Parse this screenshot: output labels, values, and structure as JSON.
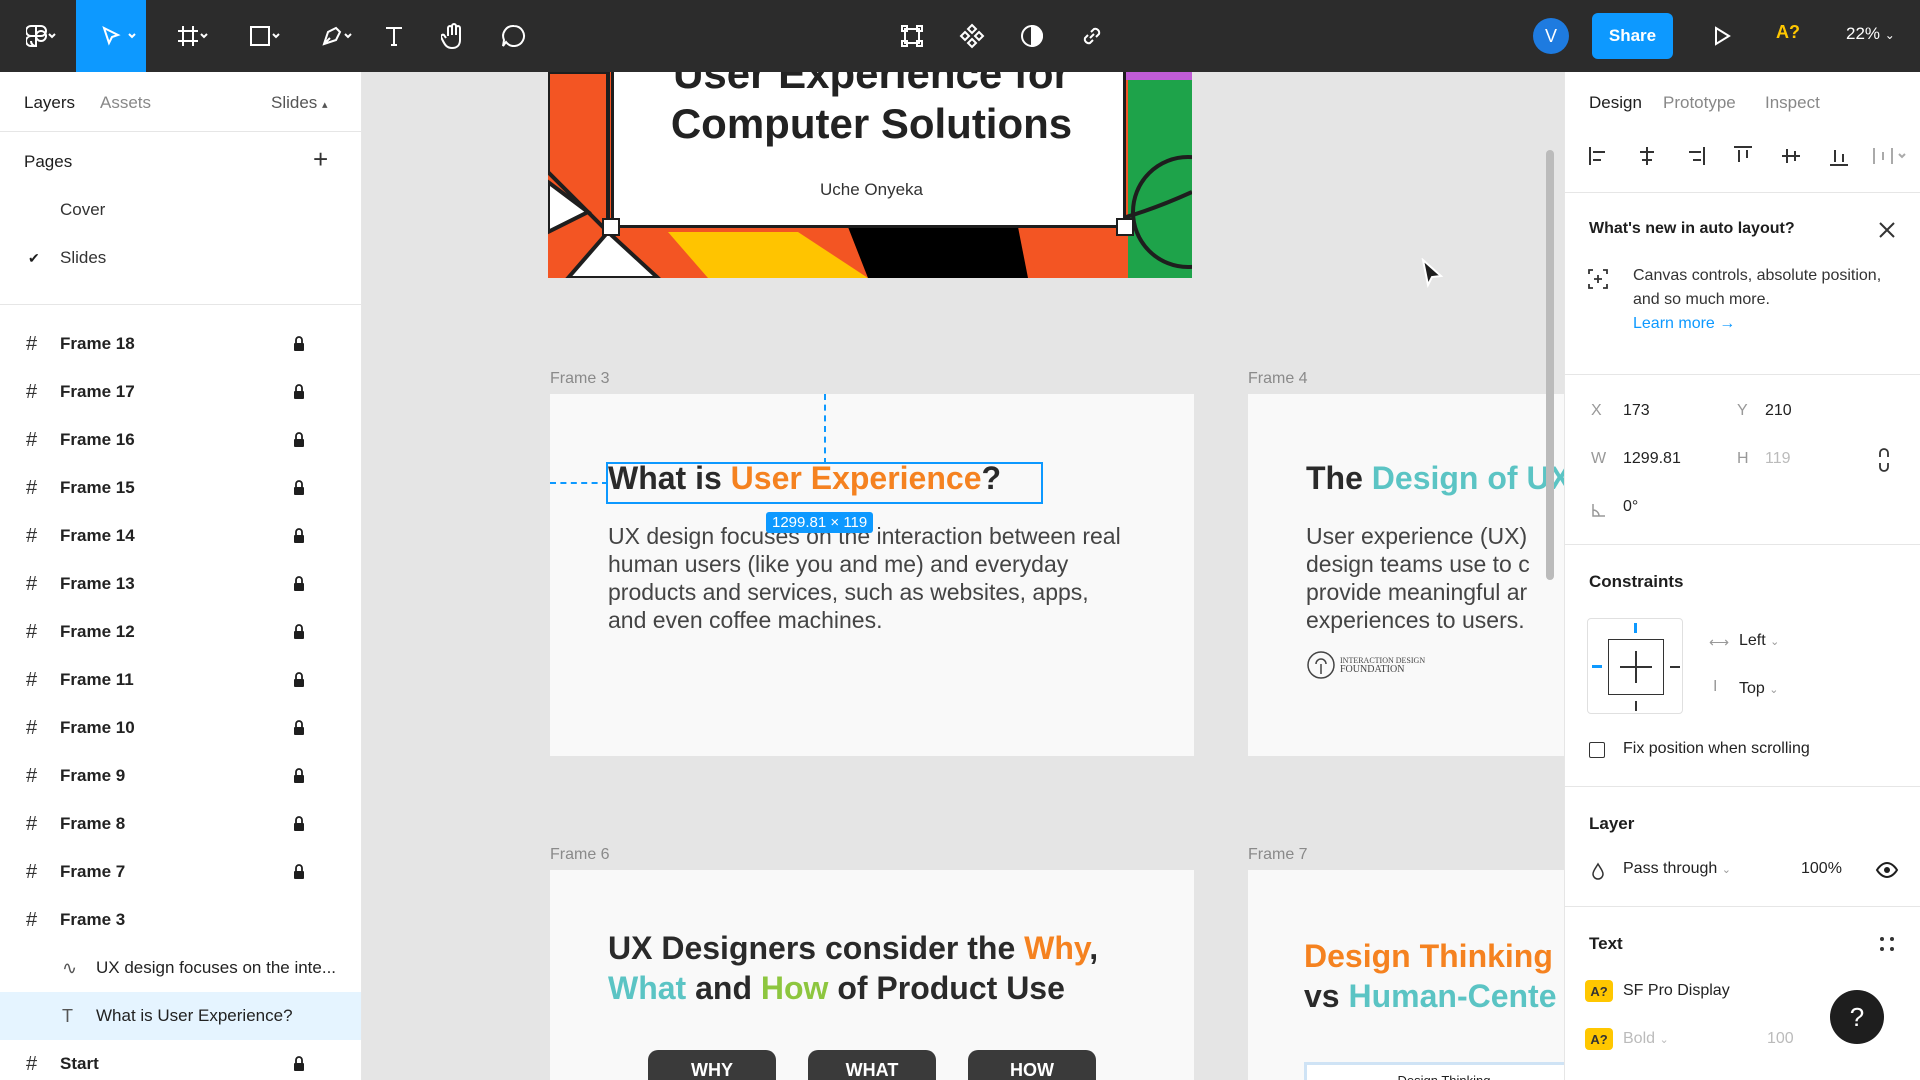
{
  "toolbar": {
    "share_label": "Share",
    "avatar_initial": "V",
    "missing_font_label": "A?",
    "zoom": "22%"
  },
  "left_panel": {
    "tabs": [
      "Layers",
      "Assets"
    ],
    "page_selector": "Slides",
    "pages_header": "Pages",
    "pages": [
      "Cover",
      "Slides"
    ],
    "layers": [
      {
        "name": "Frame 18",
        "locked": true
      },
      {
        "name": "Frame 17",
        "locked": true
      },
      {
        "name": "Frame 16",
        "locked": true
      },
      {
        "name": "Frame 15",
        "locked": true
      },
      {
        "name": "Frame 14",
        "locked": true
      },
      {
        "name": "Frame 13",
        "locked": true
      },
      {
        "name": "Frame 12",
        "locked": true
      },
      {
        "name": "Frame 11",
        "locked": true
      },
      {
        "name": "Frame 10",
        "locked": true
      },
      {
        "name": "Frame 9",
        "locked": true
      },
      {
        "name": "Frame 8",
        "locked": true
      },
      {
        "name": "Frame 7",
        "locked": true
      },
      {
        "name": "Frame 3",
        "locked": false
      },
      {
        "name": "UX design focuses on the inte...",
        "locked": false,
        "child": true
      },
      {
        "name": "What is User Experience?",
        "locked": false,
        "child": true,
        "selected": true
      },
      {
        "name": "Start",
        "locked": true
      }
    ]
  },
  "canvas": {
    "cover": {
      "title_line1": "User Experience for",
      "title_line2": "Computer Solutions",
      "author": "Uche Onyeka"
    },
    "frame3": {
      "label": "Frame 3",
      "heading_pre": "What is ",
      "heading_accent": "User Experience",
      "heading_post": "?",
      "body": "UX design focuses on the interaction between real human users (like you and me) and everyday products and services, such as websites, apps, and even coffee machines.",
      "dimension_tag": "1299.81 × 119"
    },
    "frame4": {
      "label": "Frame 4",
      "heading_pre": "The ",
      "heading_accent": "Design of UX",
      "body": "User experience (UX) design teams use to c provide meaningful ar experiences to users.",
      "logo_text_1": "INTERACTION DESIGN",
      "logo_text_2": "FOUNDATION"
    },
    "frame6": {
      "label": "Frame 6",
      "line1_pre": "UX Designers consider the ",
      "line1_accent": "Why",
      "line1_post": ",",
      "line2_a": "What",
      "line2_b": " and ",
      "line2_c": "How",
      "line2_d": " of Product Use",
      "pills": [
        "WHY",
        "WHAT",
        "HOW"
      ]
    },
    "frame7": {
      "label": "Frame 7",
      "line1": "Design Thinking",
      "line2_pre": "vs ",
      "line2_accent": "Human-Cente",
      "box_label": "Design Thinking"
    }
  },
  "right_panel": {
    "tabs": [
      "Design",
      "Prototype",
      "Inspect"
    ],
    "whats_new": {
      "title": "What's new in auto layout?",
      "text": "Canvas controls, absolute position, and so much more.",
      "link": "Learn more →"
    },
    "x_label": "X",
    "x": "173",
    "y_label": "Y",
    "y": "210",
    "w_label": "W",
    "w": "1299.81",
    "h_label": "H",
    "h": "119",
    "rotation": "0°",
    "constraints": {
      "header": "Constraints",
      "horizontal": "Left",
      "vertical": "Top",
      "fix_position": "Fix position when scrolling"
    },
    "layer": {
      "header": "Layer",
      "blend": "Pass through",
      "opacity": "100%"
    },
    "text": {
      "header": "Text",
      "font_family": "SF Pro Display",
      "font_weight": "Bold",
      "font_size": "100",
      "missing_badge": "A?"
    }
  },
  "colors": {
    "accent": "#0d99ff",
    "orange": "#f58220",
    "teal": "#5bc4c4",
    "green": "#8dc63f",
    "warning": "#ffc700"
  }
}
